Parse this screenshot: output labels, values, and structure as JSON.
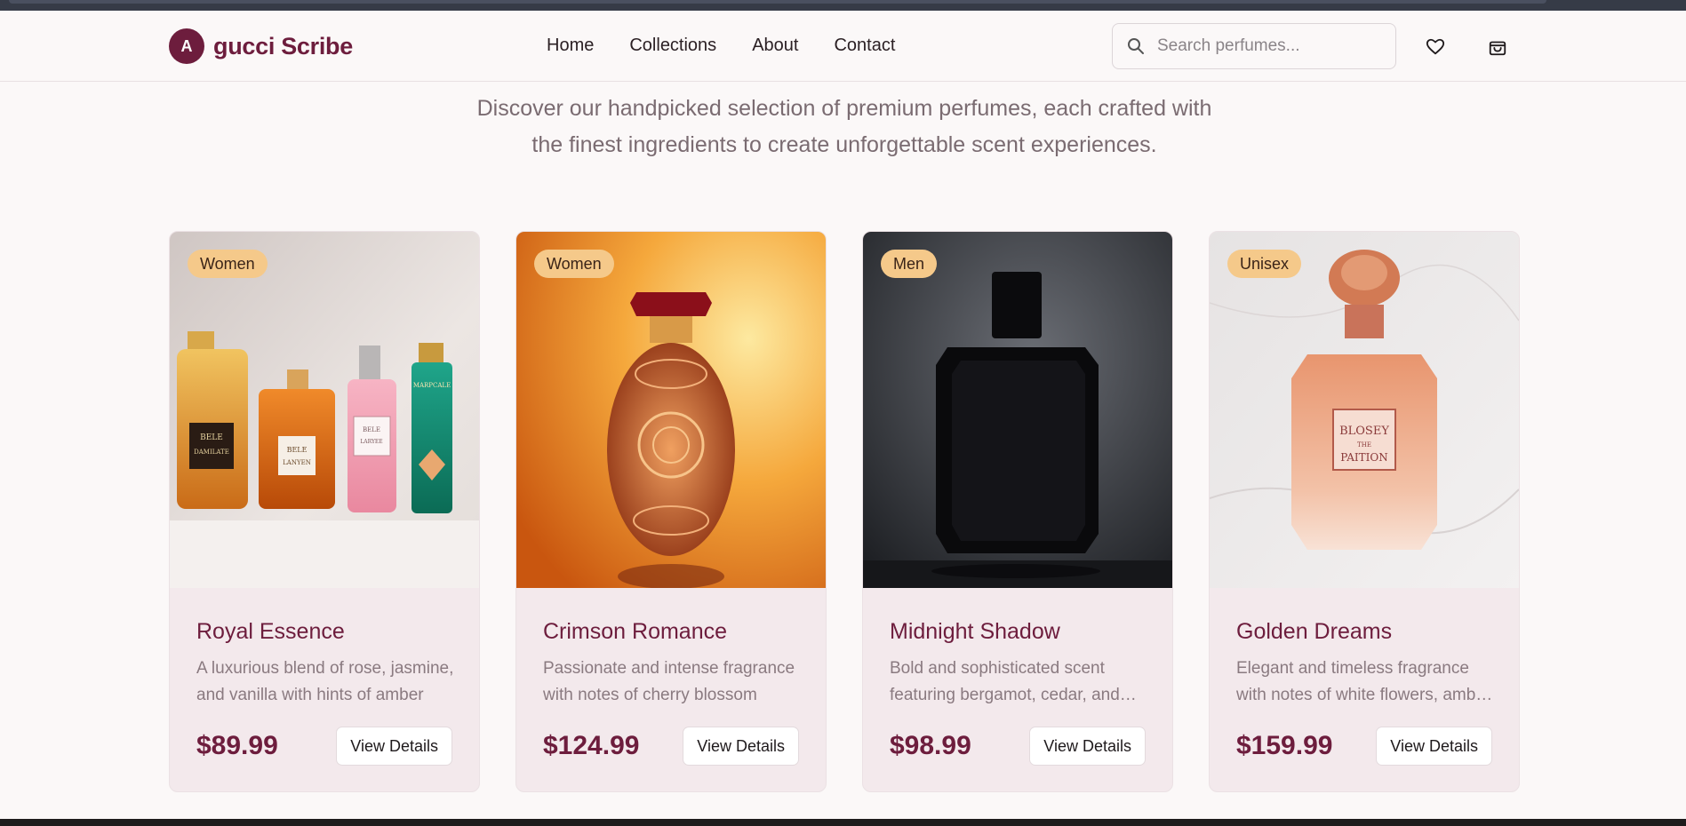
{
  "brand": {
    "initial": "A",
    "name": "gucci Scribe",
    "color": "#6d1d3d"
  },
  "nav": [
    {
      "label": "Home"
    },
    {
      "label": "Collections"
    },
    {
      "label": "About"
    },
    {
      "label": "Contact"
    }
  ],
  "search": {
    "placeholder": "Search perfumes...",
    "value": ""
  },
  "header_icons": [
    "heart-icon",
    "shopping-bag-icon"
  ],
  "hero": {
    "line1": "Discover our handpicked selection of premium perfumes, each crafted with",
    "line2": "the finest ingredients to create unforgettable scent experiences."
  },
  "products": [
    {
      "category": "Women",
      "name": "Royal Essence",
      "description": "A luxurious blend of rose, jasmine, and vanilla with hints of amber",
      "price": "$89.99",
      "button": "View Details"
    },
    {
      "category": "Women",
      "name": "Crimson Romance",
      "description": "Passionate and intense fragrance with notes of cherry blossom",
      "price": "$124.99",
      "button": "View Details"
    },
    {
      "category": "Men",
      "name": "Midnight Shadow",
      "description": "Bold and sophisticated scent featuring bergamot, cedar, and musk",
      "price": "$98.99",
      "button": "View Details"
    },
    {
      "category": "Unisex",
      "name": "Golden Dreams",
      "description": "Elegant and timeless fragrance with notes of white flowers, amber and musk",
      "price": "$159.99",
      "button": "View Details"
    }
  ],
  "bottle_labels": {
    "p1": [
      "BELE",
      "DAMILATE",
      "BELE",
      "LANYEN",
      "BELE",
      "LARYEE",
      "MARPCALE"
    ],
    "p4": [
      "BLOSEY",
      "THE",
      "PAITION"
    ]
  },
  "colors": {
    "accent": "#6d1d3d",
    "badge": "#f5c98a",
    "card_bg": "#f3e9ec"
  }
}
